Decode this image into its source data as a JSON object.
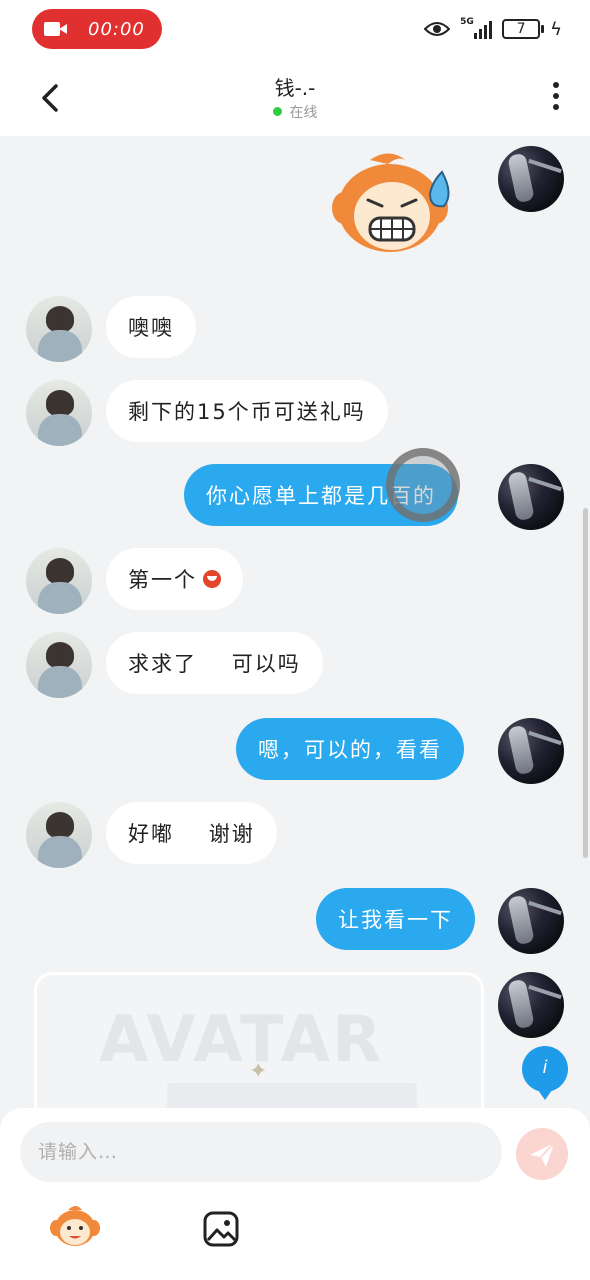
{
  "status_bar": {
    "record_time": "00:00",
    "network_label": "5G",
    "battery_level": "7",
    "icons": [
      "video-camera-icon",
      "eye-icon",
      "signal-icon",
      "battery-icon",
      "charging-bolt-icon"
    ]
  },
  "header": {
    "title": "钱-.-",
    "status": "在线"
  },
  "messages": [
    {
      "from": "self",
      "type": "sticker",
      "sticker": "monkey-sweat-sticker"
    },
    {
      "from": "peer",
      "type": "text",
      "text": "噢噢"
    },
    {
      "from": "peer",
      "type": "text",
      "text": "剩下的15个币可送礼吗"
    },
    {
      "from": "self",
      "type": "text",
      "text": "你心愿单上都是几百的"
    },
    {
      "from": "peer",
      "type": "text",
      "text": "第一个"
    },
    {
      "from": "peer",
      "type": "text",
      "text": "求求了    可以吗"
    },
    {
      "from": "self",
      "type": "text",
      "text": "嗯，可以的，看看"
    },
    {
      "from": "peer",
      "type": "text",
      "text": "好嘟    谢谢"
    },
    {
      "from": "self",
      "type": "text",
      "text": "让我看一下"
    },
    {
      "from": "self",
      "type": "card",
      "watermark": "AVATAR"
    }
  ],
  "info_button": "i",
  "input": {
    "placeholder": "请输入…"
  },
  "colors": {
    "outgoing_bubble": "#2aa9ee",
    "incoming_bubble": "#ffffff",
    "background": "#f2f3f5",
    "record_pill": "#e0302f",
    "online_dot": "#2ecc40",
    "send_button": "#fbd6d1"
  }
}
